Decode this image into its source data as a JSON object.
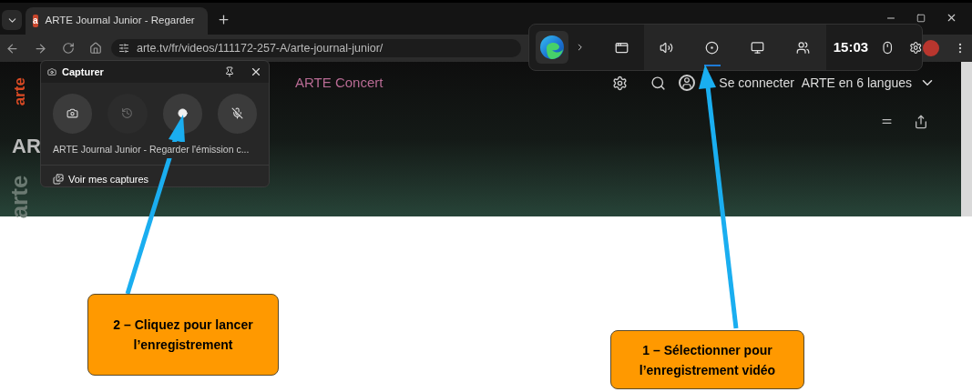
{
  "browser": {
    "tab": {
      "title": "ARTE Journal Junior - Regarder",
      "favicon": "a"
    },
    "address": "arte.tv/fr/videos/111172-257-A/arte-journal-junior/"
  },
  "page": {
    "logo": "arte",
    "nav_links": [
      {
        "label": "ARTE Concert"
      }
    ],
    "actions": [
      {
        "label": "Se connecter",
        "kind": "login"
      },
      {
        "label": "ARTE en 6 langues",
        "kind": "language"
      }
    ],
    "hero_title": "AR",
    "hero_watermark": "arte"
  },
  "game_bar": {
    "time": "15:03",
    "widgets": [
      {
        "kind": "windows",
        "selected": false
      },
      {
        "kind": "audio",
        "selected": false
      },
      {
        "kind": "capture",
        "selected": true
      },
      {
        "kind": "performance",
        "selected": false
      },
      {
        "kind": "social",
        "selected": false
      }
    ]
  },
  "capture_widget": {
    "title": "Capturer",
    "buttons": [
      {
        "kind": "screenshot",
        "disabled": false
      },
      {
        "kind": "record_last",
        "disabled": true
      },
      {
        "kind": "record",
        "disabled": false
      },
      {
        "kind": "mic",
        "disabled": false
      }
    ],
    "source": "ARTE Journal Junior - Regarder l'émission c...",
    "gallery_link": "Voir mes captures"
  },
  "callouts": [
    {
      "text": "2 – Cliquez pour lancer l’enregistrement"
    },
    {
      "text": "1 – Sélectionner pour l’enregistrement vidéo"
    }
  ]
}
